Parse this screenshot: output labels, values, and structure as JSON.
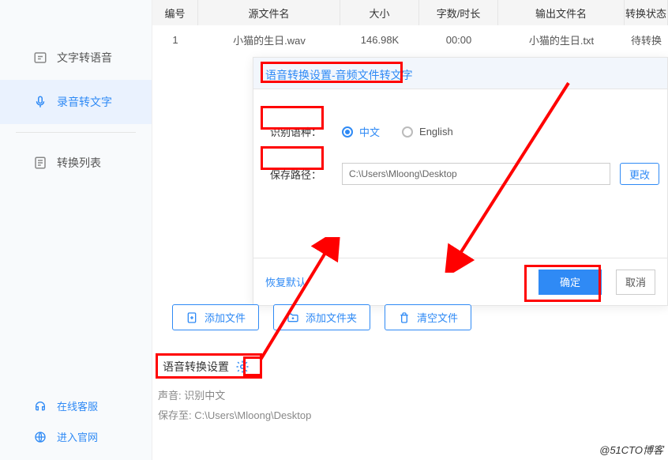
{
  "sidebar": {
    "items": [
      {
        "label": "文字转语音"
      },
      {
        "label": "录音转文字"
      },
      {
        "label": "转换列表"
      }
    ],
    "bottom": [
      {
        "label": "在线客服"
      },
      {
        "label": "进入官网"
      }
    ]
  },
  "table": {
    "headers": {
      "id": "编号",
      "src": "源文件名",
      "size": "大小",
      "dur": "字数/时长",
      "out": "输出文件名",
      "status": "转换状态"
    },
    "rows": [
      {
        "id": "1",
        "src": "小猫的生日.wav",
        "size": "146.98K",
        "dur": "00:00",
        "out": "小猫的生日.txt",
        "status": "待转换"
      }
    ]
  },
  "panel": {
    "title": "语音转换设置-音频文件转文字",
    "lang_label": "识别语种：",
    "lang_options": {
      "zh": "中文",
      "en": "English"
    },
    "path_label": "保存路径：",
    "path_value": "C:\\Users\\Mloong\\Desktop",
    "change": "更改",
    "restore": "恢复默认",
    "confirm": "确定",
    "cancel": "取消"
  },
  "toolbar": {
    "add_file": "添加文件",
    "add_folder": "添加文件夹",
    "clear": "清空文件"
  },
  "settings": {
    "title": "语音转换设置",
    "voice_label": "声音:",
    "voice_value": "识别中文",
    "save_label": "保存至:",
    "save_value": "C:\\Users\\Mloong\\Desktop"
  },
  "watermark": "@51CTO博客"
}
